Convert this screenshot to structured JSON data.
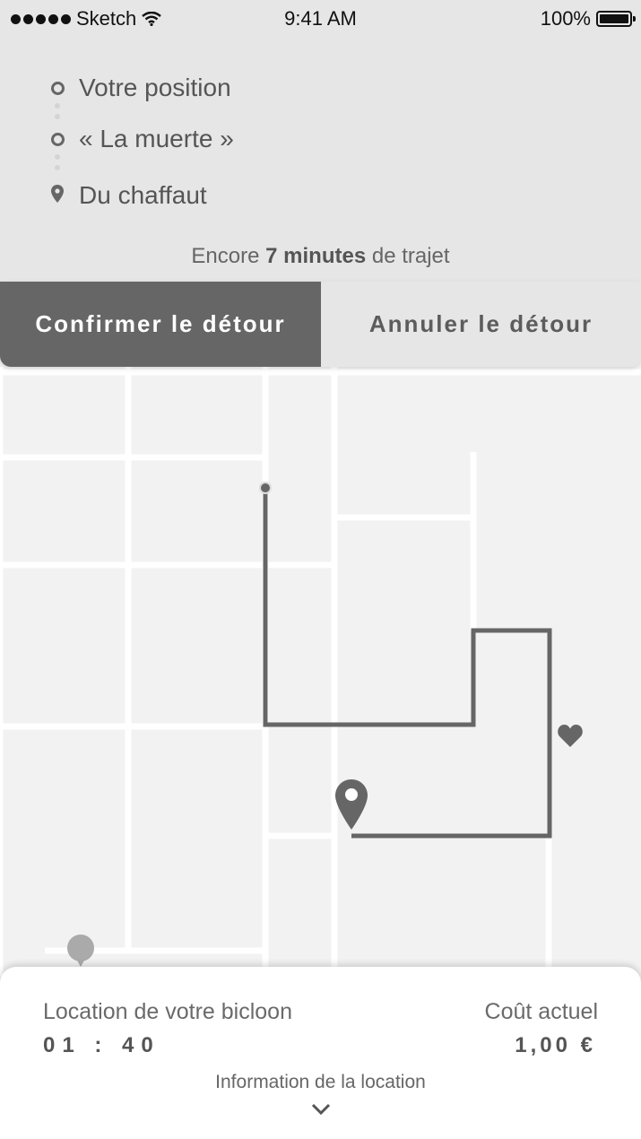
{
  "status_bar": {
    "carrier": "Sketch",
    "time": "9:41 AM",
    "battery": "100%"
  },
  "route": {
    "stops": [
      {
        "label": "Votre position",
        "icon": "circle-marker-icon"
      },
      {
        "label": "« La muerte »",
        "icon": "circle-marker-icon"
      },
      {
        "label": "Du chaffaut",
        "icon": "pin-icon"
      }
    ],
    "trip_prefix": "Encore",
    "trip_duration": "7 minutes",
    "trip_suffix": "de trajet"
  },
  "actions": {
    "confirm_label": "Confirmer le détour",
    "cancel_label": "Annuler le détour"
  },
  "rental": {
    "label": "Location de votre bicloon",
    "time": "01 : 40",
    "cost_label": "Coût actuel",
    "cost_value": "1,00 €",
    "info_label": "Information de la location"
  },
  "colors": {
    "panel": "#e6e6e6",
    "primary": "#666666",
    "map_bg": "#f2f2f2",
    "road": "#ffffff"
  }
}
